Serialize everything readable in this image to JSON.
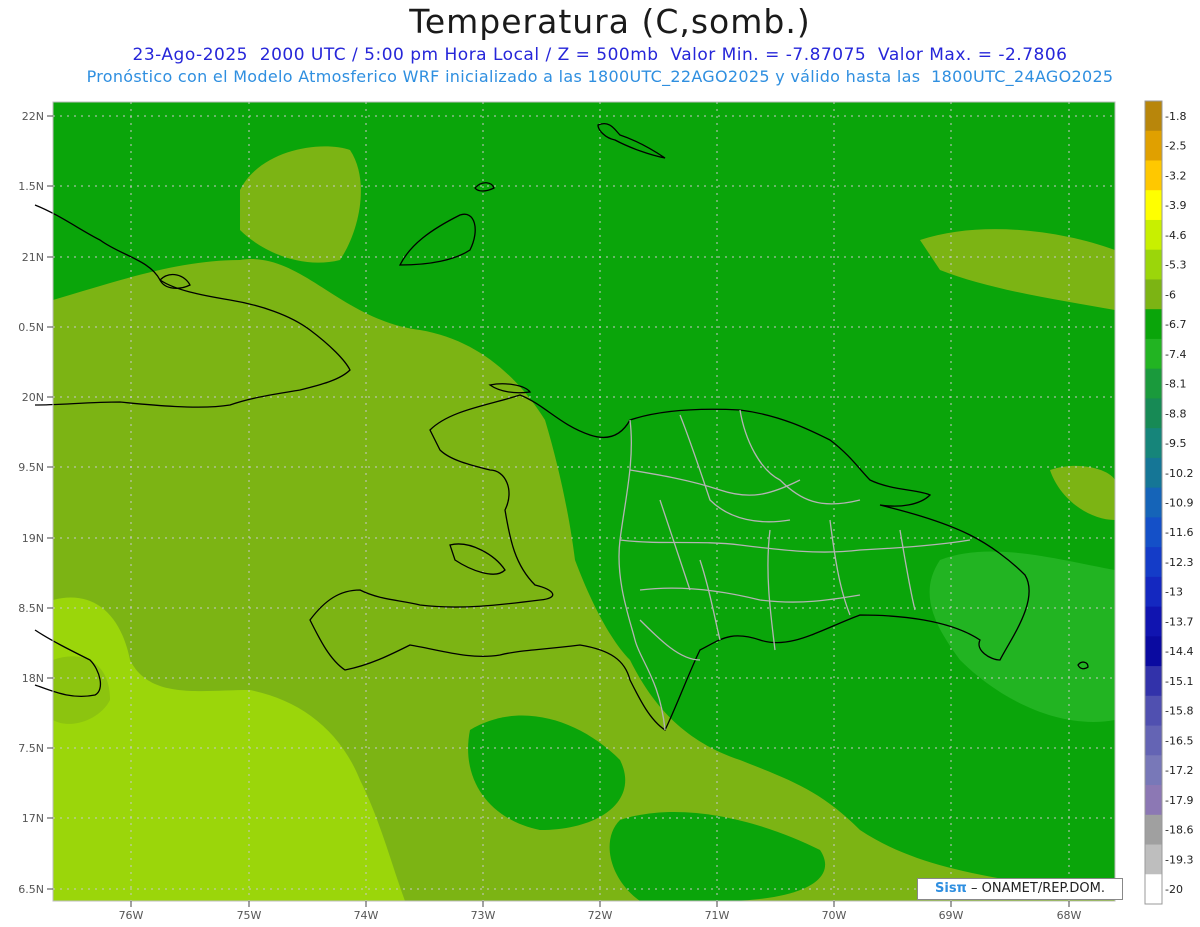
{
  "header": {
    "title": "Temperatura (C,somb.)",
    "line1": "23-Ago-2025  2000 UTC / 5:00 pm Hora Local / Z = 500mb  Valor Min. = -7.87075  Valor Max. = -2.7806",
    "line2": "Pronóstico con el Modelo Atmosferico WRF inicializado a las 1800UTC_22AGO2025 y válido hasta las  1800UTC_24AGO2025"
  },
  "axes": {
    "lat_labels": [
      "22N",
      "1.5N",
      "21N",
      "0.5N",
      "20N",
      "9.5N",
      "19N",
      "8.5N",
      "18N",
      "7.5N",
      "17N",
      "6.5N"
    ],
    "lon_labels": [
      "76W",
      "75W",
      "74W",
      "73W",
      "72W",
      "71W",
      "70W",
      "69W",
      "68W"
    ]
  },
  "colorbar": {
    "labels": [
      "-1.8",
      "-2.5",
      "-3.2",
      "-3.9",
      "-4.6",
      "-5.3",
      "-6",
      "-6.7",
      "-7.4",
      "-8.1",
      "-8.8",
      "-9.5",
      "-10.2",
      "-10.9",
      "-11.6",
      "-12.3",
      "-13",
      "-13.7",
      "-14.4",
      "-15.1",
      "-15.8",
      "-16.5",
      "-17.2",
      "-17.9",
      "-18.6",
      "-19.3",
      "-20"
    ],
    "colors": [
      "#b8860b",
      "#e0a000",
      "#ffc800",
      "#ffff00",
      "#c8f000",
      "#9bd60a",
      "#7cb414",
      "#0aa50a",
      "#22b422",
      "#1a9a3c",
      "#178a55",
      "#16857a",
      "#157696",
      "#1564b8",
      "#1450c8",
      "#143cc8",
      "#1428c0",
      "#1014b0",
      "#0a0aa0",
      "#3232aa",
      "#5050b0",
      "#6464b4",
      "#7878b8",
      "#8c78b4",
      "#a0a0a0",
      "#bebebe",
      "#ffffff"
    ]
  },
  "credit": {
    "brand": "Sisπ",
    "text": " – ONAMET/REP.DOM."
  }
}
